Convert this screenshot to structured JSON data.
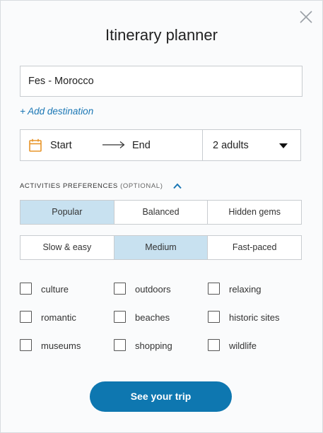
{
  "header": {
    "title": "Itinerary planner",
    "close_icon": "close-icon"
  },
  "destination": {
    "value": "Fes - Morocco",
    "add_label": "+ Add destination"
  },
  "dates": {
    "start_label": "Start",
    "end_label": "End",
    "travelers": "2 adults"
  },
  "preferences": {
    "label": "ACTIVITIES PREFERENCES",
    "optional": "(OPTIONAL)",
    "popularity": {
      "options": [
        "Popular",
        "Balanced",
        "Hidden gems"
      ],
      "selected": "Popular"
    },
    "pace": {
      "options": [
        "Slow & easy",
        "Medium",
        "Fast-paced"
      ],
      "selected": "Medium"
    },
    "interests": [
      [
        "culture",
        "outdoors",
        "relaxing"
      ],
      [
        "romantic",
        "beaches",
        "historic sites"
      ],
      [
        "museums",
        "shopping",
        "wildlife"
      ]
    ]
  },
  "cta": {
    "label": "See your trip"
  },
  "colors": {
    "accent": "#0e77b0",
    "link": "#1b77b5",
    "selected": "#c8e1f0",
    "calendar": "#e8952a"
  }
}
